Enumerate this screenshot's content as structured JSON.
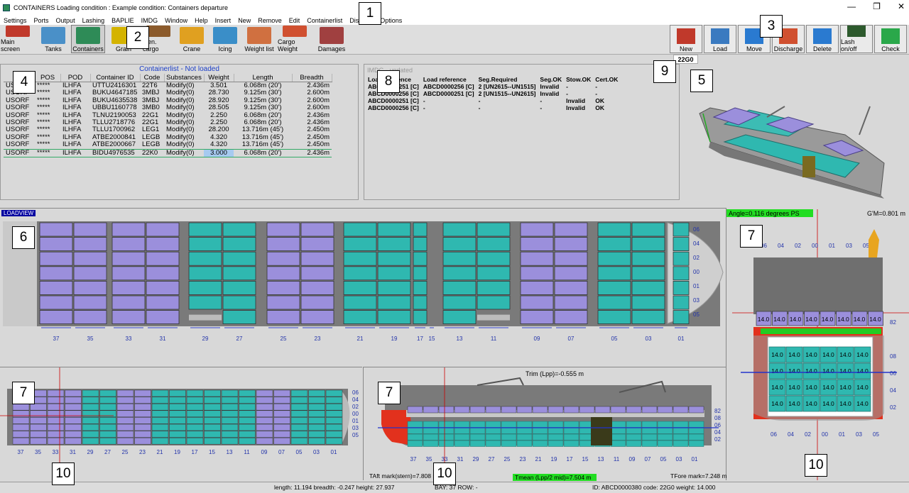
{
  "window": {
    "title": "CONTAINERS  Loading condition : Example condition: Containers departure",
    "minimize": "—",
    "maximize": "❐",
    "close": "✕"
  },
  "menu": [
    "Settings",
    "Ports",
    "Output",
    "Lashing",
    "BAPLIE",
    "IMDG",
    "Window",
    "Help",
    "Insert",
    "New",
    "Remove",
    "Edit",
    "Containerlist",
    "Discharge Options"
  ],
  "toolbar_left": [
    {
      "label": "Main screen",
      "icon": "main-screen-icon"
    },
    {
      "label": "Tanks",
      "icon": "tanks-icon"
    },
    {
      "label": "Containers",
      "icon": "containers-icon",
      "active": true
    },
    {
      "label": "Grain",
      "icon": "grain-icon"
    },
    {
      "label": "Gen. cargo",
      "icon": "gen-cargo-icon"
    },
    {
      "label": "Crane",
      "icon": "crane-icon"
    },
    {
      "label": "Icing",
      "icon": "icing-icon"
    },
    {
      "label": "Weight list",
      "icon": "weight-list-icon"
    },
    {
      "label": "Cargo Weight",
      "icon": "cargo-weight-icon"
    },
    {
      "label": "Damages",
      "icon": "damages-icon"
    }
  ],
  "toolbar_right": [
    {
      "label": "New",
      "icon": "new-icon"
    },
    {
      "label": "Load",
      "icon": "load-icon"
    },
    {
      "label": "Move",
      "icon": "move-icon"
    },
    {
      "label": "Discharge",
      "icon": "discharge-icon"
    },
    {
      "label": "Delete",
      "icon": "delete-icon"
    },
    {
      "label": "Lash on/off",
      "icon": "lash-icon"
    },
    {
      "label": "Check",
      "icon": "check-icon"
    }
  ],
  "container_type": "22G0",
  "containerlist": {
    "header": "Containerlist - Not loaded",
    "columns": [
      "L",
      "POS",
      "POD",
      "Container ID",
      "Code",
      "Substances",
      "Weight",
      "Length",
      "Breadth"
    ],
    "rows": [
      [
        "USORF",
        "*****",
        "ILHFA",
        "UTTU2416301",
        "22T6",
        "Modify(0)",
        "3.501",
        "6.068m (20')",
        "2.436m"
      ],
      [
        "USORF",
        "*****",
        "ILHFA",
        "BUKU4647185",
        "3MBJ",
        "Modify(0)",
        "28.730",
        "9.125m (30')",
        "2.600m"
      ],
      [
        "USORF",
        "*****",
        "ILHFA",
        "BUKU4635538",
        "3MBJ",
        "Modify(0)",
        "28.920",
        "9.125m (30')",
        "2.600m"
      ],
      [
        "USORF",
        "*****",
        "ILHFA",
        "UBBU1160778",
        "3MB0",
        "Modify(0)",
        "28.505",
        "9.125m (30')",
        "2.600m"
      ],
      [
        "USORF",
        "*****",
        "ILHFA",
        "TLNU2190053",
        "22G1",
        "Modify(0)",
        "2.250",
        "6.068m (20')",
        "2.436m"
      ],
      [
        "USORF",
        "*****",
        "ILHFA",
        "TLLU2718776",
        "22G1",
        "Modify(0)",
        "2.250",
        "6.068m (20')",
        "2.436m"
      ],
      [
        "USORF",
        "*****",
        "ILHFA",
        "TLLU1700962",
        "LEG1",
        "Modify(0)",
        "28.200",
        "13.716m (45')",
        "2.450m"
      ],
      [
        "USORF",
        "*****",
        "ILHFA",
        "ATBE2000841",
        "LEGB",
        "Modify(0)",
        "4.320",
        "13.716m (45')",
        "2.450m"
      ],
      [
        "USORF",
        "*****",
        "ILHFA",
        "ATBE2000667",
        "LEGB",
        "Modify(0)",
        "4.320",
        "13.716m (45')",
        "2.450m"
      ],
      [
        "USORF",
        "*****",
        "ILHFA",
        "BIDU4976535",
        "22K0",
        "Modify(0)",
        "3.000",
        "6.068m (20')",
        "2.436m"
      ]
    ]
  },
  "imdg": {
    "title": "IMDG - updated",
    "columns": [
      "Load reference",
      "Load reference",
      "Seg.Required",
      "Seg.OK",
      "Stow.OK",
      "Cert.OK"
    ],
    "rows": [
      [
        "ABCD0000251 [C]",
        "ABCD0000256 [C]",
        "2 [UN2615--UN1515]",
        "Invalid",
        "-",
        "-"
      ],
      [
        "ABCD0000256 [C]",
        "ABCD0000251 [C]",
        "2 [UN1515--UN2615]",
        "Invalid",
        "-",
        "-"
      ],
      [
        "ABCD0000251 [C]",
        "-",
        "-",
        "-",
        "Invalid",
        "OK"
      ],
      [
        "ABCD0000256 [C]",
        "-",
        "-",
        "-",
        "Invalid",
        "OK"
      ]
    ]
  },
  "loadview": {
    "label": "LOADVIEW",
    "bays": [
      "37",
      "35",
      "33",
      "31",
      "29",
      "27",
      "25",
      "23",
      "21",
      "19",
      "17",
      "15",
      "13",
      "11",
      "09",
      "07",
      "05",
      "03",
      "01"
    ],
    "rows": [
      "06",
      "04",
      "02",
      "00",
      "01",
      "03",
      "05"
    ]
  },
  "section": {
    "angle": "Angle=0.116 degrees PS",
    "gm": "G'M=0.801 m",
    "rows_top": [
      "06",
      "04",
      "02",
      "00",
      "01",
      "03",
      "05"
    ],
    "rows_bottom": [
      "06",
      "04",
      "02",
      "00",
      "01",
      "03",
      "05"
    ],
    "cell": "14.0",
    "tiers_right": [
      "82",
      "08",
      "06",
      "04",
      "02"
    ]
  },
  "bay_view": {
    "bays": [
      "37",
      "35",
      "33",
      "31",
      "29",
      "27",
      "25",
      "23",
      "21",
      "19",
      "17",
      "15",
      "13",
      "11",
      "09",
      "07",
      "05",
      "03",
      "01"
    ],
    "tiers": [
      "06",
      "04",
      "02",
      "00",
      "01",
      "03",
      "05"
    ]
  },
  "profile": {
    "trim": "Trim (Lpp)=-0.555 m",
    "aft": "TAft mark(stern)=7.808 m",
    "mean": "Tmean (Lpp/2 mid)=7.504 m",
    "fore": "TFore mark=7.248 m",
    "tiers": [
      "82",
      "08",
      "06",
      "04",
      "02"
    ]
  },
  "status": {
    "dims": "length: 11.194 breadth: -0.247 height: 27.937",
    "bay": "BAY: 37 ROW: -",
    "id": "ID: ABCD0000380 code: 22G0 weight: 14.000"
  },
  "callouts": [
    "1",
    "2",
    "3",
    "4",
    "5",
    "6",
    "7",
    "7",
    "7",
    "8",
    "9",
    "10",
    "10",
    "10"
  ],
  "colors": {
    "teal": "#2fb8b0",
    "purple": "#9b8fdc",
    "grid": "#5c5c5c",
    "hull_red": "#e2311d",
    "selection": "#a6caf0"
  }
}
